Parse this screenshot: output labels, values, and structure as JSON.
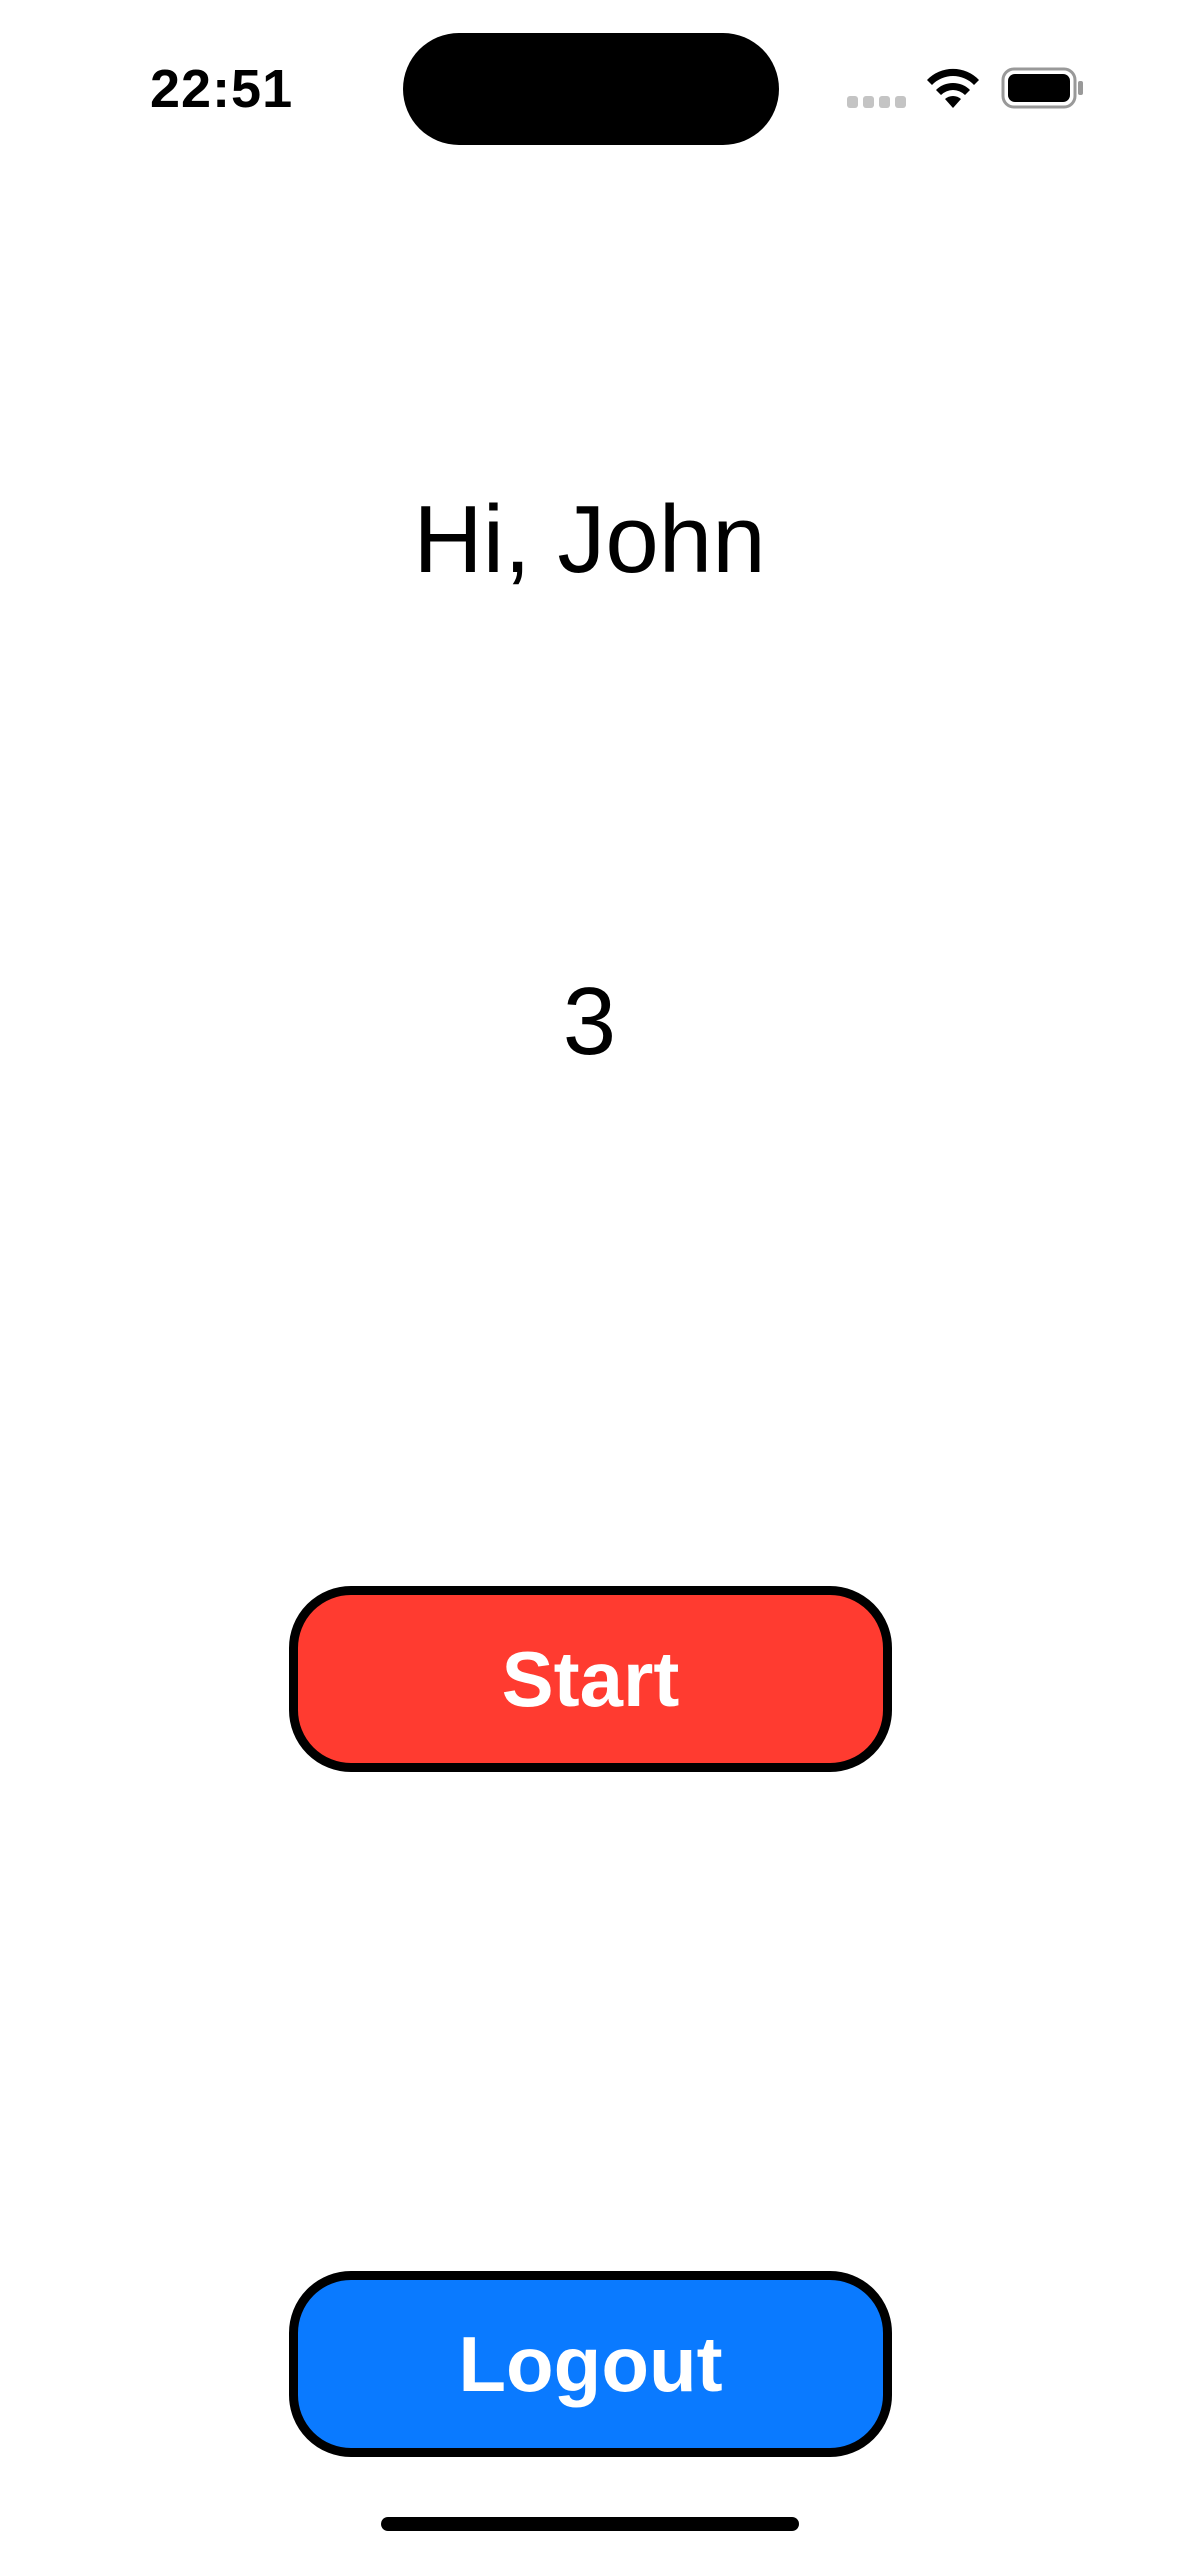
{
  "status_bar": {
    "time": "22:51",
    "signal_icon": "cellular-signal-icon",
    "wifi_icon": "wifi-icon",
    "battery_icon": "battery-icon"
  },
  "main": {
    "greeting": "Hi, John",
    "counter": "3",
    "start_label": "Start",
    "logout_label": "Logout"
  },
  "colors": {
    "start_button": "#ff3b30",
    "logout_button": "#0a7aff",
    "button_border": "#000000"
  }
}
